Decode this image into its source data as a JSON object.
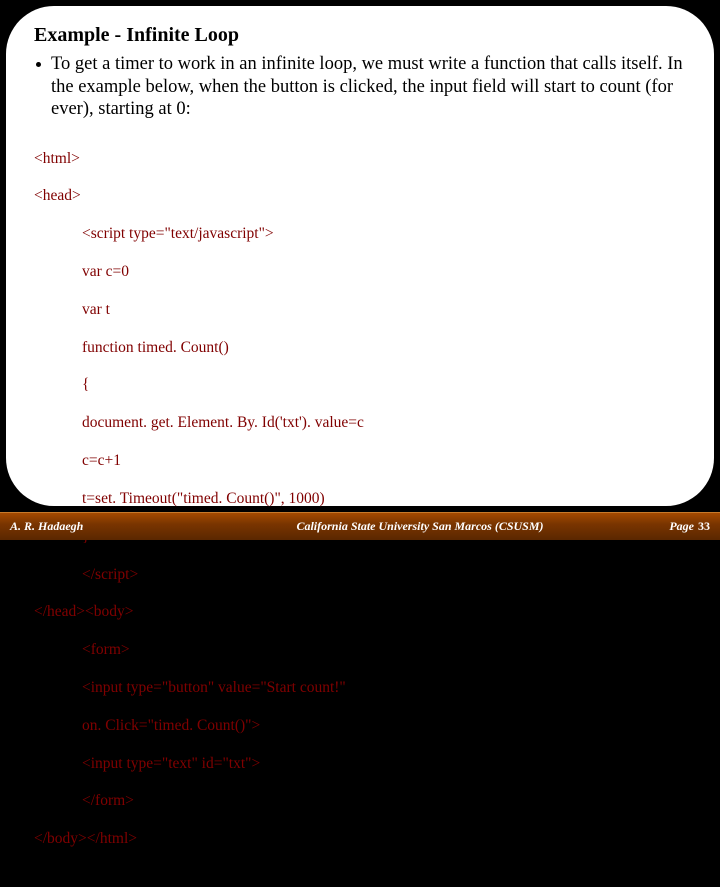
{
  "title": "Example - Infinite Loop",
  "bullet": "To get a timer to work in an infinite loop, we must write a function that calls itself. In the example below, when the button is clicked, the input field will start to count (for ever), starting at 0:",
  "code": {
    "l1": "<html>",
    "l2": "<head>",
    "l3": "<script type=\"text/javascript\">",
    "l4": "var c=0",
    "l5": "var t",
    "l6": "function timed. Count()",
    "l7": "{",
    "l8": "document. get. Element. By. Id('txt'). value=c",
    "l9": "c=c+1",
    "l10": "t=set. Timeout(\"timed. Count()\", 1000)",
    "l11": "}",
    "l12": "</script>",
    "l13": "</head><body>",
    "l14": "<form>",
    "l15": "<input type=\"button\" value=\"Start count!\"",
    "l16": "on. Click=\"timed. Count()\">",
    "l17": "<input type=\"text\" id=\"txt\">",
    "l18": "</form>",
    "l19": "</body></html>"
  },
  "footer": {
    "author": "A. R. Hadaegh",
    "institution": "California State University San Marcos (CSUSM)",
    "page_label": "Page",
    "page_num": "33"
  }
}
